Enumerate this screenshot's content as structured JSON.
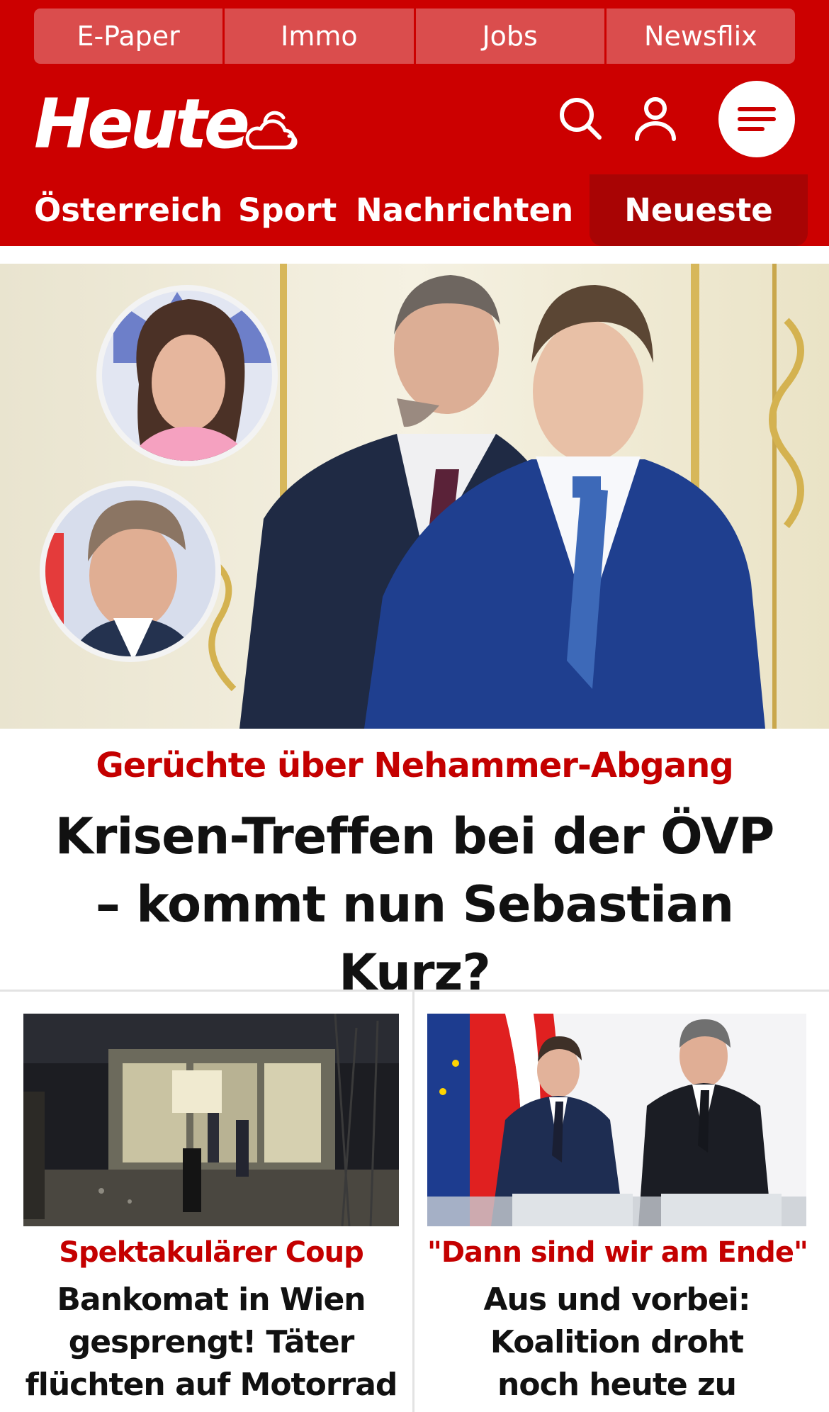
{
  "top_nav": [
    "E-Paper",
    "Immo",
    "Jobs",
    "Newsflix"
  ],
  "brand": {
    "logo_text": "Heute",
    "weather_icon": "cloud-sun-icon"
  },
  "header_icons": [
    "search-icon",
    "user-icon",
    "hamburger-menu-icon"
  ],
  "main_nav": {
    "items": [
      "Österreich",
      "Sport",
      "Nachrichten"
    ],
    "active": "Neueste"
  },
  "hero": {
    "kicker": "Gerüchte über Nehammer-Abgang",
    "headline": "Krisen-Treffen bei der ÖVP – kommt nun Sebastian Kurz?"
  },
  "teasers": [
    {
      "kicker": "Spektakulärer Coup",
      "headline": "Bankomat in Wien gesprengt! Täter flüchten auf Motorrad"
    },
    {
      "kicker": "\"Dann sind wir am Ende\"",
      "headline": "Aus und vorbei: Koalition droht noch heute zu platzen"
    }
  ],
  "colors": {
    "brand_red": "#cc0000",
    "top_nav_bg": "#da4d4d",
    "active_tab_bg": "#a80404",
    "kicker_red": "#c40000",
    "headline_text": "#111111"
  }
}
